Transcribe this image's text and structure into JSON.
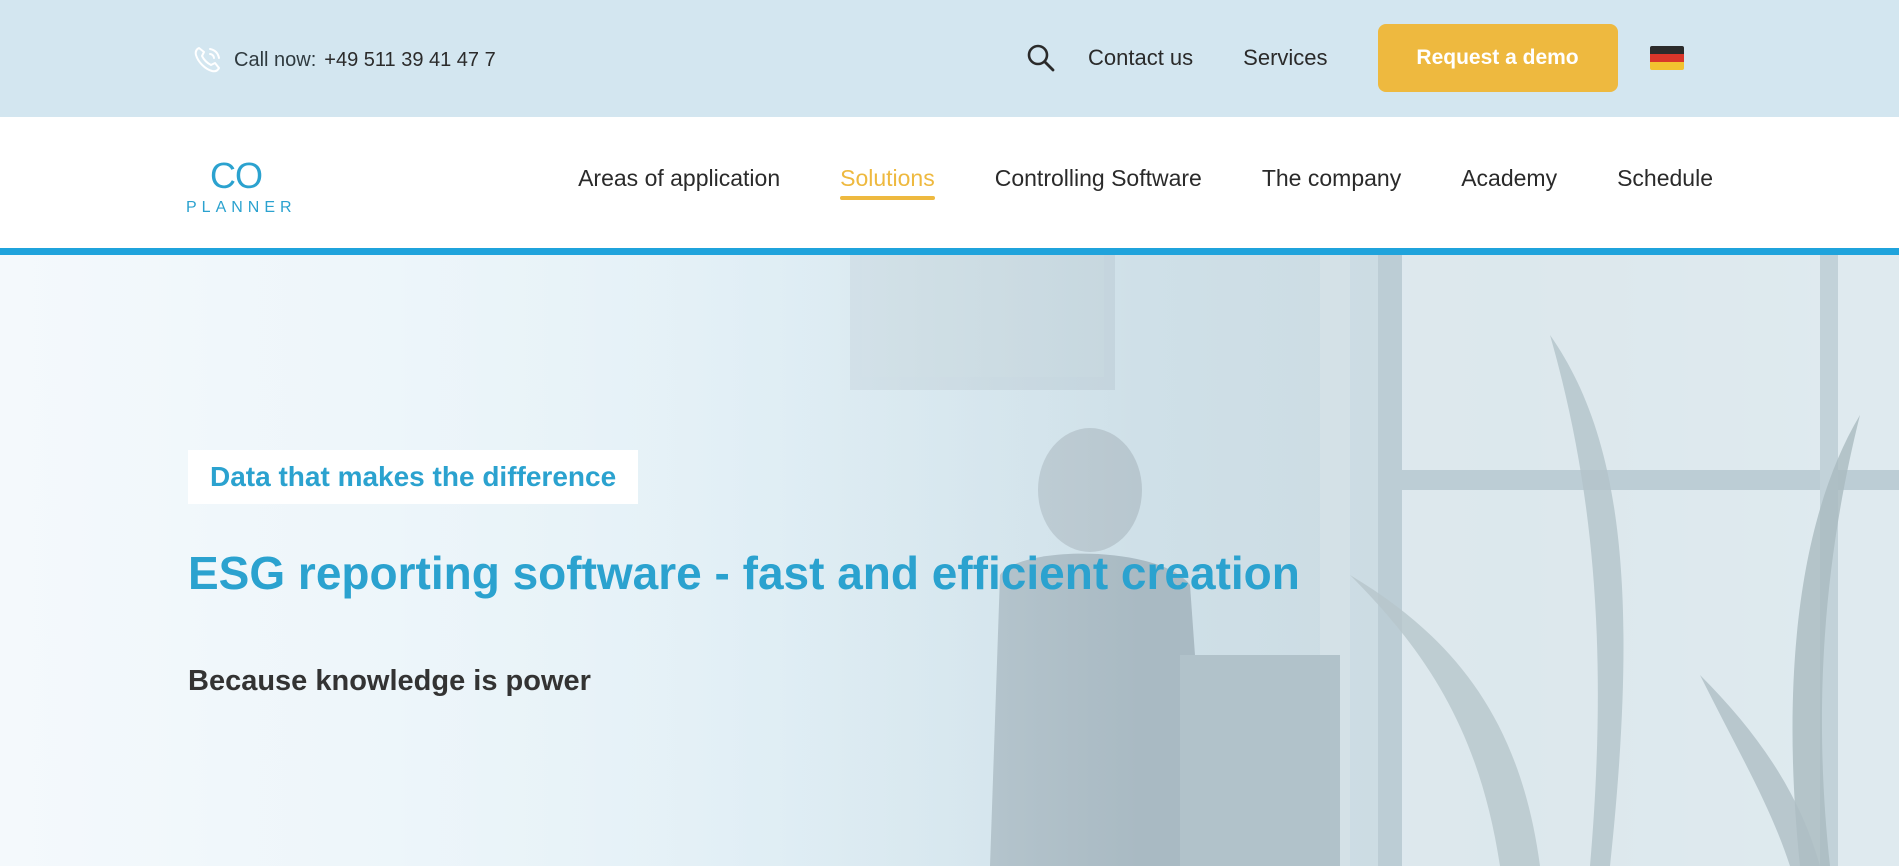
{
  "topbar": {
    "call_label": "Call now:",
    "phone_number": "+49 511 39 41 47 7",
    "links": [
      "Contact us",
      "Services"
    ],
    "demo_button": "Request a demo",
    "language_flag": "german-flag-icon"
  },
  "header": {
    "logo_top": "CO",
    "logo_bottom": "PLANNER",
    "nav": [
      {
        "label": "Areas of application",
        "active": false
      },
      {
        "label": "Solutions",
        "active": true
      },
      {
        "label": "Controlling Software",
        "active": false
      },
      {
        "label": "The company",
        "active": false
      },
      {
        "label": "Academy",
        "active": false
      },
      {
        "label": "Schedule",
        "active": false
      }
    ]
  },
  "hero": {
    "tagline": "Data that makes the difference",
    "title": "ESG reporting software - fast and efficient creation",
    "subtitle": "Because knowledge is power"
  },
  "colors": {
    "accent_blue": "#2ba2cf",
    "accent_yellow": "#eeb93f",
    "topbar_bg": "#d3e6f0",
    "divider_blue": "#1fa3dc"
  }
}
